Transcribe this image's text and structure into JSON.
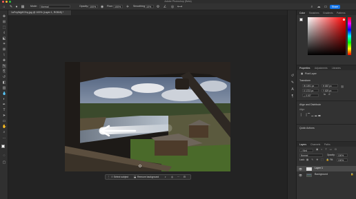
{
  "window": {
    "title": "Adobe Photoshop (Beta)"
  },
  "options_bar": {
    "mode_label": "Mode:",
    "mode_value": "Normal",
    "opacity_label": "Opacity:",
    "opacity_value": "100%",
    "flow_label": "Flow:",
    "flow_value": "100%",
    "smoothing_label": "Smoothing:",
    "smoothing_value": "10%",
    "share_label": "Share"
  },
  "document_tab": {
    "label": "1uFnyWg9Cf1q.jpg @ 100% (Layer 1, RGB/8) *"
  },
  "toolbar": {
    "tools": [
      "move-tool",
      "artboard-tool",
      "marquee-tool",
      "lasso-tool",
      "object-select-tool",
      "crop-tool",
      "frame-tool",
      "eyedropper-tool",
      "healing-tool",
      "brush-tool",
      "clone-tool",
      "history-brush-tool",
      "eraser-tool",
      "gradient-tool",
      "blur-tool",
      "dodge-tool",
      "pen-tool",
      "type-tool",
      "path-select-tool",
      "rectangle-tool",
      "hand-tool",
      "zoom-tool",
      "more-tools"
    ]
  },
  "contextual_taskbar": {
    "select_subject": "Select subject",
    "remove_background": "Remove background"
  },
  "color_panel": {
    "tabs": [
      "Color",
      "Swatches",
      "Gradients",
      "Patterns"
    ],
    "active_tab": "Color",
    "colors": {
      "hue_base": "#ff0000",
      "foreground": "#ffffff",
      "background": "#000000"
    }
  },
  "properties_panel": {
    "tabs": [
      "Properties",
      "Adjustments",
      "Libraries"
    ],
    "active_tab": "Properties",
    "layer_type": "Pixel Layer",
    "transform_label": "Transform",
    "w": "W  1891 px",
    "h": "H  887 px",
    "x": "X  1723 px",
    "y": "Y  829 px",
    "angle": "△  0.00°",
    "align_label": "Align and Distribute",
    "align_sub": "Align:",
    "quick_actions_label": "Quick Actions"
  },
  "layers_panel": {
    "tabs": [
      "Layers",
      "Channels",
      "Paths"
    ],
    "active_tab": "Layers",
    "kind_filter": "Kind",
    "blend_mode": "Normal",
    "opacity_label": "Opacity:",
    "opacity_value": "100%",
    "lock_label": "Lock:",
    "fill_label": "Fill:",
    "fill_value": "100%",
    "layers": [
      {
        "name": "Layer 1",
        "selected": true
      },
      {
        "name": "Background",
        "selected": false
      }
    ]
  }
}
